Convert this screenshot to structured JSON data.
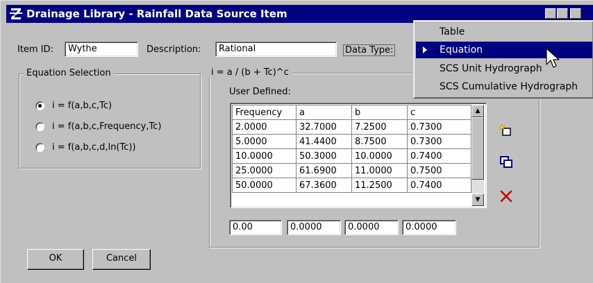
{
  "window": {
    "title": "Drainage Library - Rainfall Data Source Item"
  },
  "item_id": {
    "label": "Item ID:",
    "value": "Wythe"
  },
  "description": {
    "label": "Description:",
    "value": "Rational"
  },
  "data_type": {
    "label": "Data Type:",
    "menu_items": [
      "Table",
      "Equation",
      "SCS Unit Hydrograph",
      "SCS Cumulative Hydrograph"
    ],
    "selected": "Equation"
  },
  "equation_selection": {
    "title": "Equation Selection",
    "options": [
      "i = f(a,b,c,Tc)",
      "i = f(a,b,c,Frequency,Tc)",
      "i = f(a,b,c,d,ln(Tc))"
    ],
    "selected_index": 0
  },
  "equation": {
    "title": "i = a / (b + Tc)^c",
    "user_defined_label": "User Defined:"
  },
  "table": {
    "columns": [
      "Frequency",
      "a",
      "b",
      "c"
    ],
    "rows": [
      [
        "2.0000",
        "32.7000",
        "7.2500",
        "0.7300"
      ],
      [
        "5.0000",
        "41.4400",
        "8.7500",
        "0.7300"
      ],
      [
        "10.0000",
        "50.3000",
        "10.0000",
        "0.7400"
      ],
      [
        "25.0000",
        "61.6900",
        "11.0000",
        "0.7500"
      ],
      [
        "50.0000",
        "67.3600",
        "11.2500",
        "0.7400"
      ]
    ],
    "entry_values": [
      "0.00",
      "0.0000",
      "0.0000",
      "0.0000"
    ]
  },
  "buttons": {
    "ok": "OK",
    "cancel": "Cancel"
  },
  "icons": {
    "add": "add-row-icon",
    "copy": "copy-row-icon",
    "delete": "delete-row-icon"
  },
  "colors": {
    "titlebar": "#000080",
    "selection": "#000080",
    "delete": "#c00000"
  }
}
